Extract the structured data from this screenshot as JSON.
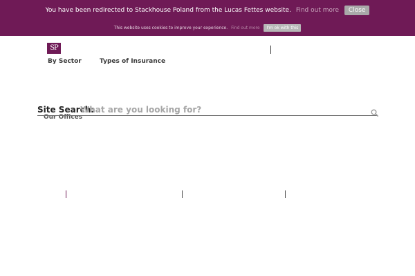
{
  "redirect_banner": {
    "message": "You have been redirected to Stackhouse Poland from the Lucas Fettes website.",
    "find_out_more": "Find out more",
    "close_label": "Close"
  },
  "cookie_banner": {
    "message": "This website uses cookies to improve your experience.",
    "find_out_more": "Find out more",
    "ok_label": "I'm ok with this"
  },
  "logo": {
    "text": "SP"
  },
  "nav": {
    "items": [
      {
        "label": "By Sector"
      },
      {
        "label": "Types of Insurance"
      }
    ]
  },
  "search": {
    "label": "Site Search:",
    "placeholder": "What are you looking for?"
  },
  "offices": {
    "label": "Our Offices"
  },
  "colors": {
    "brand": "#6f1a56",
    "close_button": "#a9a9a9",
    "cookie_button": "#b7b7b7"
  },
  "icons": {
    "search": "search-icon"
  }
}
